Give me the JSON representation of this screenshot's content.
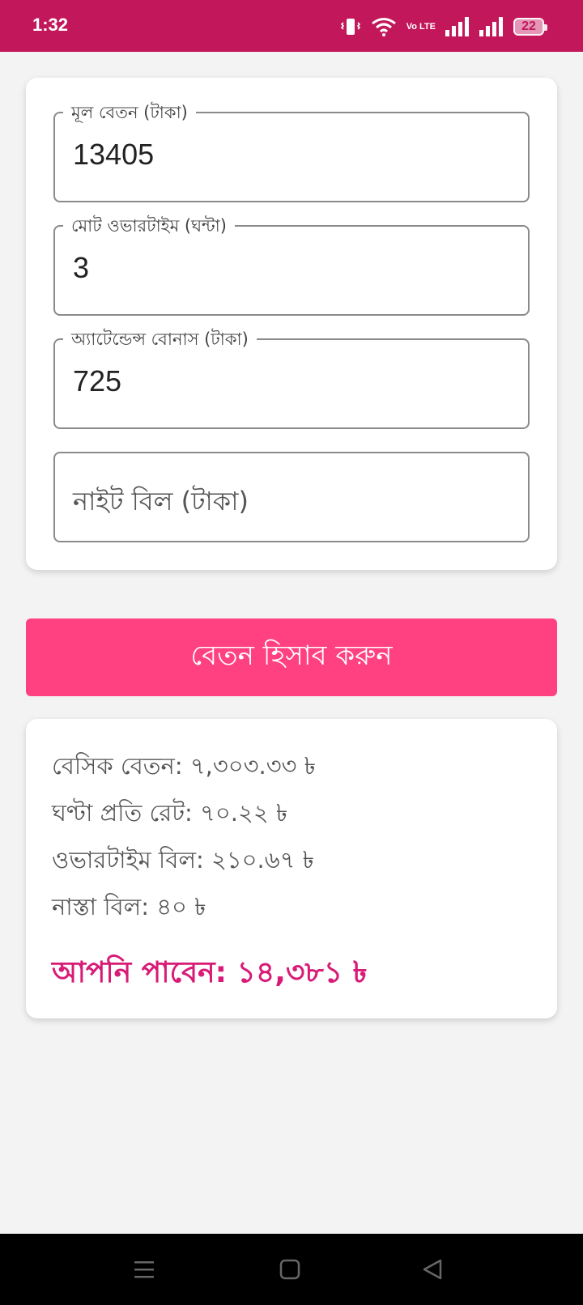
{
  "status_bar": {
    "time": "1:32",
    "network_label": "Vo LTE",
    "battery": "22"
  },
  "form": {
    "basic_salary": {
      "label": "মূল বেতন (টাকা)",
      "value": "13405"
    },
    "overtime_hours": {
      "label": "মোট ওভারটাইম (ঘন্টা)",
      "value": "3"
    },
    "attendance_bonus": {
      "label": "অ্যাটেন্ডেন্স বোনাস (টাকা)",
      "value": "725"
    },
    "night_bill": {
      "placeholder": "নাইট বিল (টাকা)",
      "value": ""
    }
  },
  "calculate_button": "বেতন হিসাব করুন",
  "results": {
    "basic": "বেসিক বেতন: ৭,৩০৩.৩৩ ৳",
    "hourly_rate": "ঘণ্টা প্রতি রেট: ৭০.২২ ৳",
    "overtime_bill": "ওভারটাইম বিল: ২১০.৬৭ ৳",
    "snack_bill": "নাস্তা বিল: ৪০ ৳",
    "total": "আপনি পাবেন: ১৪,৩৮১ ৳"
  },
  "colors": {
    "status_bar": "#c2185b",
    "button": "#ff4081",
    "total_text": "#d81b77"
  }
}
